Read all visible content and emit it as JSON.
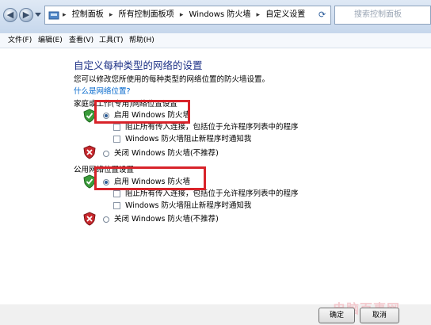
{
  "address": {
    "crumbs": [
      "控制面板",
      "所有控制面板项",
      "Windows 防火墙",
      "自定义设置"
    ],
    "search_placeholder": "搜索控制面板"
  },
  "menu": [
    "文件(F)",
    "编辑(E)",
    "查看(V)",
    "工具(T)",
    "帮助(H)"
  ],
  "page": {
    "title": "自定义每种类型的网络的设置",
    "description": "您可以修改您所使用的每种类型的网络位置的防火墙设置。",
    "link": "什么是网络位置?"
  },
  "home_network": {
    "header": "家庭或工作(专用)网络位置设置",
    "enable_label": "启用 Windows 防火墙",
    "block_all_label": "阻止所有传入连接，包括位于允许程序列表中的程序",
    "notify_label": "Windows 防火墙阻止新程序时通知我",
    "disable_label": "关闭 Windows 防火墙(不推荐)"
  },
  "public_network": {
    "header": "公用网络位置设置",
    "enable_label": "启用 Windows 防火墙",
    "block_all_label": "阻止所有传入连接，包括位于允许程序列表中的程序",
    "notify_label": "Windows 防火墙阻止新程序时通知我",
    "disable_label": "关闭 Windows 防火墙(不推荐)"
  },
  "buttons": {
    "ok": "确定",
    "cancel": "取消"
  },
  "watermark": "电脑百事网",
  "colors": {
    "highlight": "#d8232a",
    "title": "#1e3287",
    "link": "#0066cc"
  }
}
